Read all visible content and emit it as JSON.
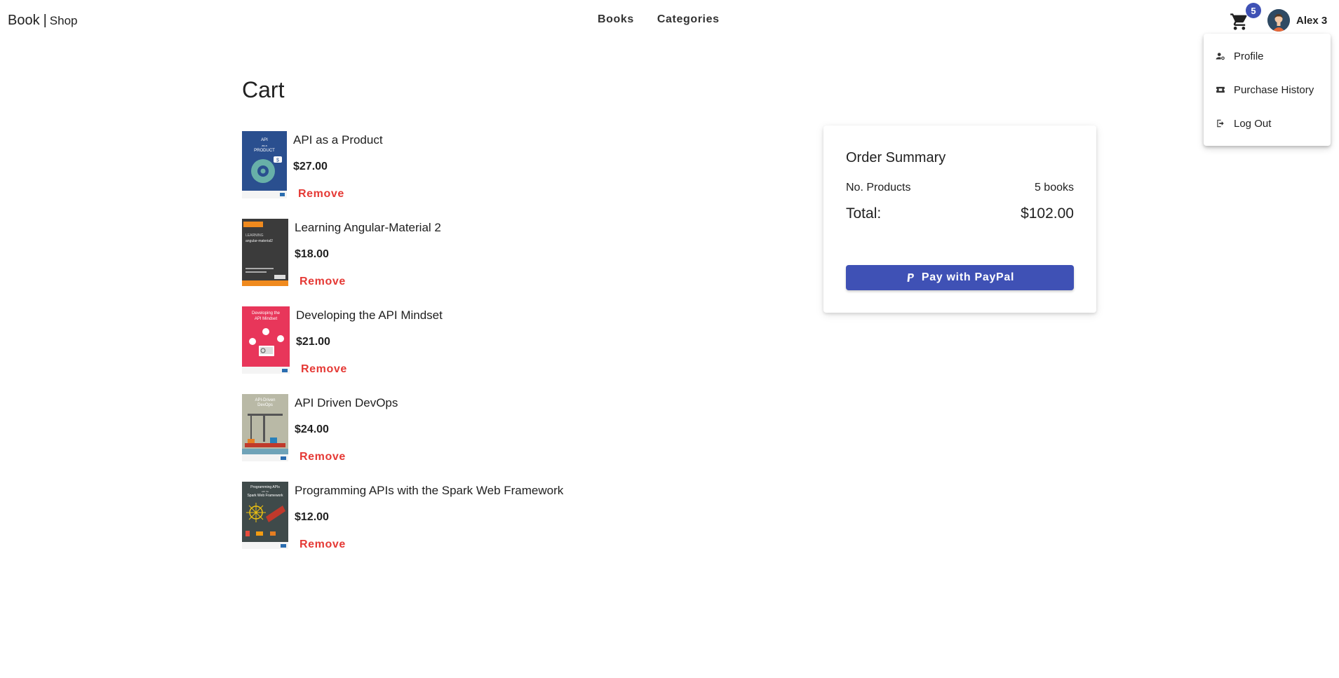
{
  "header": {
    "brand_book": "Book",
    "brand_sep": "|",
    "brand_shop": "Shop",
    "nav": [
      {
        "label": "Books"
      },
      {
        "label": "Categories"
      }
    ],
    "cart_count": "5",
    "user_name": "Alex 3"
  },
  "user_menu": {
    "items": [
      {
        "label": "Profile",
        "icon": "profile-icon"
      },
      {
        "label": "Purchase History",
        "icon": "ticket-icon"
      },
      {
        "label": "Log Out",
        "icon": "logout-icon"
      }
    ]
  },
  "page": {
    "title": "Cart"
  },
  "cart": {
    "remove_label": "Remove",
    "items": [
      {
        "title": "API as a Product",
        "price": "$27.00"
      },
      {
        "title": "Learning Angular-Material 2",
        "price": "$18.00"
      },
      {
        "title": "Developing the API Mindset",
        "price": "$21.00"
      },
      {
        "title": "API Driven DevOps",
        "price": "$24.00"
      },
      {
        "title": "Programming APIs with the Spark Web Framework",
        "price": "$12.00"
      }
    ]
  },
  "summary": {
    "title": "Order Summary",
    "products_label": "No. Products",
    "products_value": "5 books",
    "total_label": "Total:",
    "total_value": "$102.00",
    "pay_label": "Pay with PayPal"
  },
  "colors": {
    "primary": "#3f51b5",
    "remove": "#e53935"
  }
}
